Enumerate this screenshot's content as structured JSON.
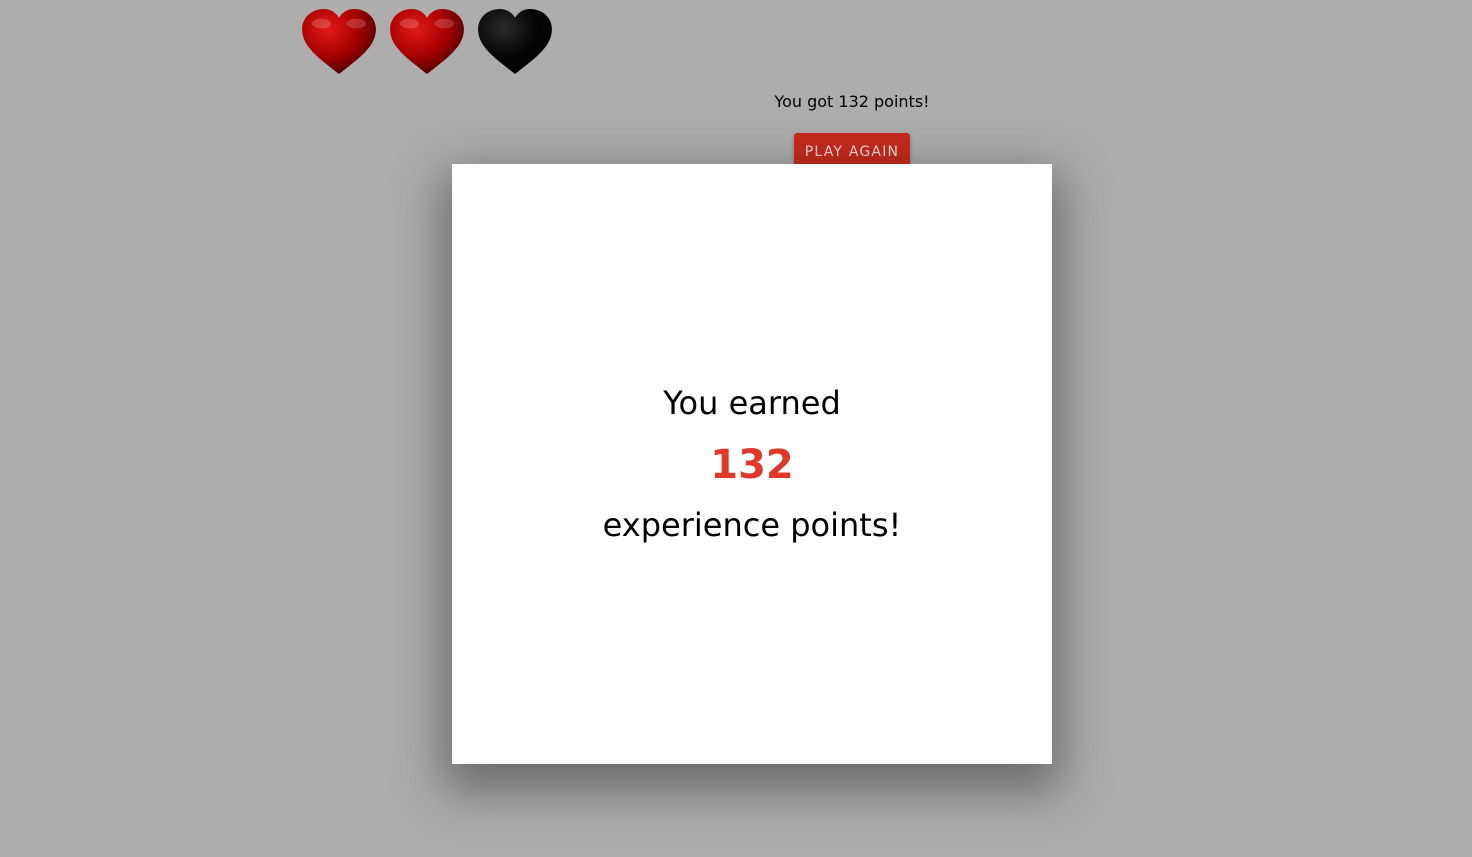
{
  "lives": {
    "total": 3,
    "remaining": 2,
    "icons": [
      "heart-full-icon",
      "heart-full-icon",
      "heart-empty-icon"
    ],
    "colors": {
      "full": "#b00000",
      "empty": "#000000"
    }
  },
  "result": {
    "score_text": "You got 132 points!",
    "play_again_label": "PLAY AGAIN"
  },
  "modal": {
    "line1": "You earned",
    "points": "132",
    "line2": "experience points!",
    "points_color": "#e0392a"
  }
}
